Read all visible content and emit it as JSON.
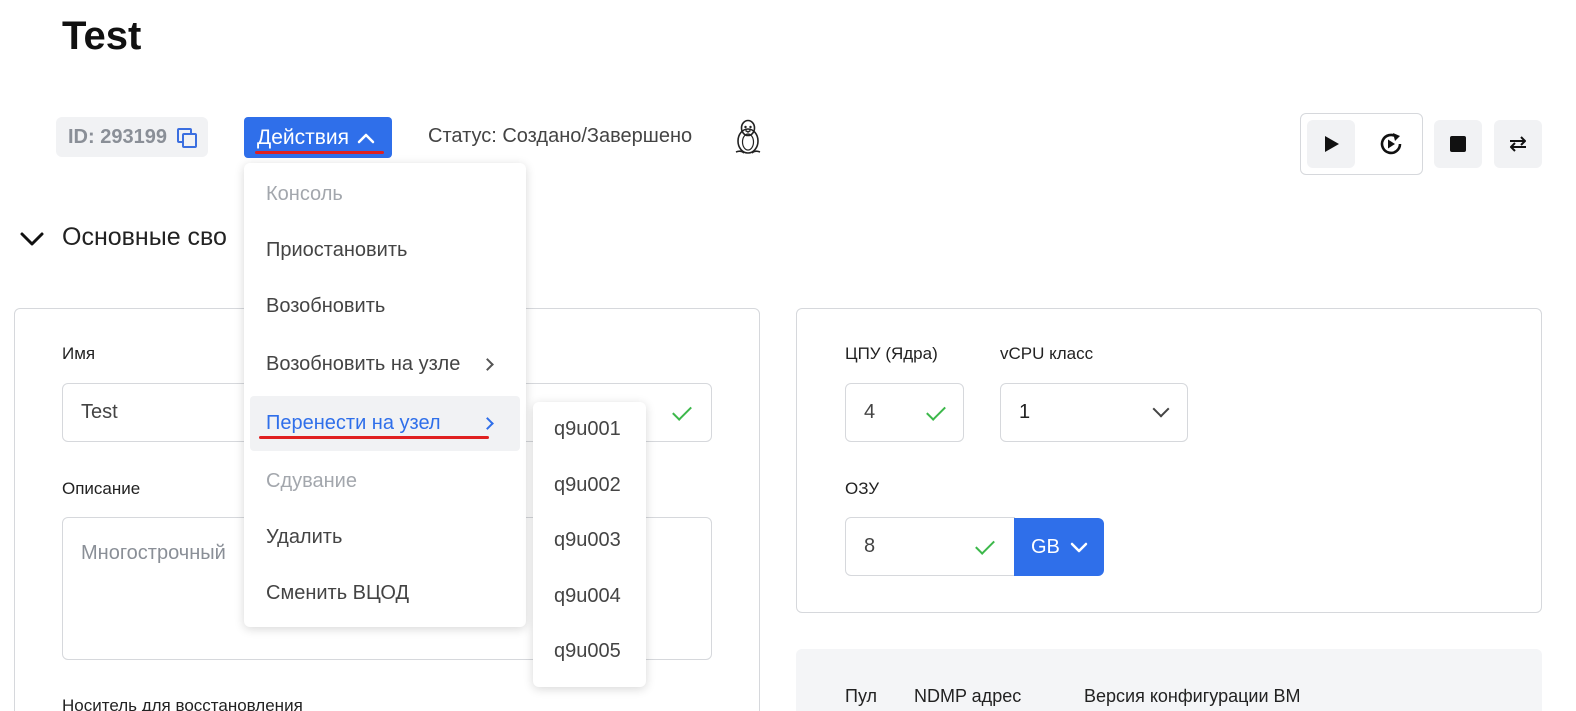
{
  "page": {
    "title": "Test"
  },
  "header": {
    "id_label": "ID: 293199",
    "actions_label": "Действия",
    "status_text": "Статус: Создано/Завершено",
    "os_icon": "linux-penguin-icon"
  },
  "toolbar": {
    "icons": [
      "play-icon",
      "restart-icon",
      "stop-icon",
      "migrate-icon"
    ]
  },
  "section": {
    "title": "Основные сво"
  },
  "form": {
    "name_label": "Имя",
    "name_value": "Test",
    "description_label": "Описание",
    "description_placeholder": "Многострочный",
    "restore_media_label": "Носитель для восстановления",
    "cpu_label": "ЦПУ (Ядра)",
    "cpu_value": "4",
    "vcpu_label": "vCPU класс",
    "vcpu_value": "1",
    "ram_label": "ОЗУ",
    "ram_value": "8",
    "ram_unit": "GB"
  },
  "info_table": {
    "headers": [
      "Пул",
      "NDMP адрес",
      "Версия конфигурации ВМ"
    ]
  },
  "actions_menu": {
    "items": [
      {
        "label": "Консоль",
        "disabled": true
      },
      {
        "label": "Приостановить",
        "disabled": false
      },
      {
        "label": "Возобновить",
        "disabled": false
      },
      {
        "label": "Возобновить на узле",
        "disabled": false,
        "submenu": true
      },
      {
        "label": "Перенести на узел",
        "disabled": false,
        "submenu": true,
        "active": true
      },
      {
        "label": "Сдувание",
        "disabled": true
      },
      {
        "label": "Удалить",
        "disabled": false
      },
      {
        "label": "Сменить ВЦОД",
        "disabled": false
      }
    ]
  },
  "node_submenu": {
    "items": [
      "q9u001",
      "q9u002",
      "q9u003",
      "q9u004",
      "q9u005"
    ]
  },
  "colors": {
    "accent": "#2f6fea",
    "annotation_red": "#e02020",
    "success_green": "#3cb84a"
  }
}
